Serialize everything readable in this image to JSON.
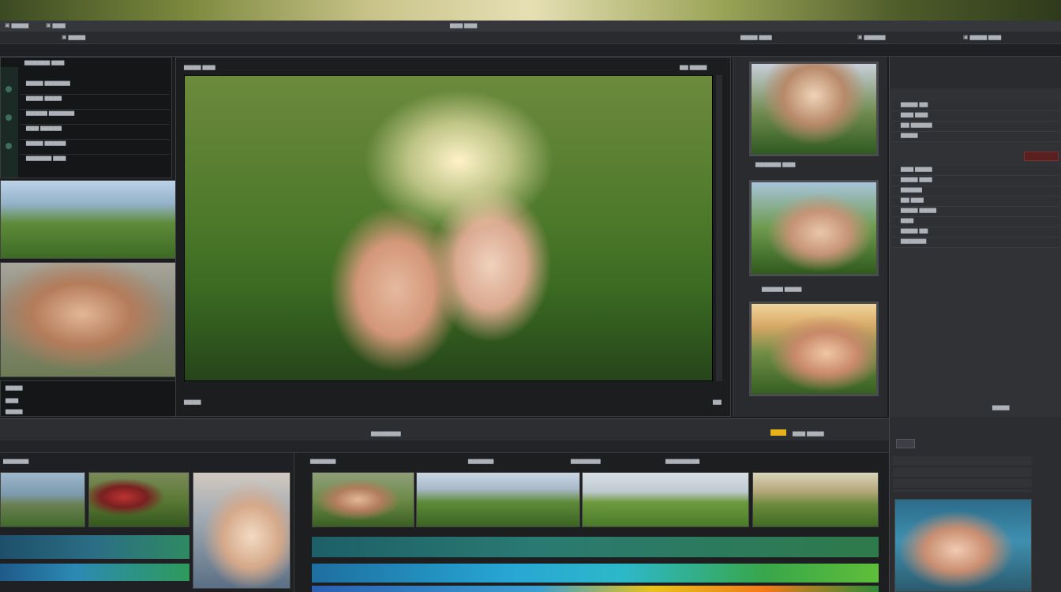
{
  "app": {
    "top_left_labels": [
      "▣ ▆▆▆▆",
      "▣ ▆▆▆",
      "▣ ▆▆▆▆"
    ],
    "top_center_label": "▆▆▆ ▆▆▆",
    "top_right_labels": [
      "▆▆▆▆ ▆▆▆",
      "▣ ▆▆▆▆▆",
      "▣ ▆▆▆▆ ▆▆▆"
    ]
  },
  "left_panel": {
    "header": "▆▆▆▆▆▆ ▆▆▆",
    "items": [
      "▆▆▆▆ ▆▆▆▆▆▆",
      "▆▆▆▆ ▆▆▆▆",
      "▆▆▆▆▆ ▆▆▆▆▆▆",
      "▆▆▆ ▆▆▆▆▆",
      "▆▆▆▆ ▆▆▆▆▆",
      "▆▆▆▆▆▆ ▆▆▆"
    ],
    "footer_labels": [
      "▆▆▆▆",
      "▆▆▆",
      "▆▆▆▆"
    ]
  },
  "viewer": {
    "header_left": "▆▆▆▆ ▆▆▆",
    "header_right": "▆▆ ▆▆▆▆",
    "footer_left": "▆▆▆▆",
    "footer_right": "▆▆"
  },
  "thumbs_column": {
    "captions": [
      "▆▆▆▆▆▆ ▆▆▆",
      "▆▆▆▆▆ ▆▆▆▆"
    ]
  },
  "right_properties": {
    "rows": [
      "▆▆▆▆ ▆▆",
      "▆▆▆ ▆▆▆",
      "▆▆ ▆▆▆▆▆",
      "▆▆▆▆",
      "▆▆▆ ▆▆▆▆",
      "▆▆▆▆ ▆▆▆",
      "▆▆▆▆▆",
      "▆▆ ▆▆▆",
      "▆▆▆▆ ▆▆▆▆",
      "▆▆▆",
      "▆▆▆▆ ▆▆",
      "▆▆▆▆▆▆"
    ],
    "bottom_label": "▆▆▆▆"
  },
  "timeline": {
    "center_label": "▆▆▆▆▆▆▆",
    "right_label": "▆▆▆ ▆▆▆▆",
    "left_track_label": "▆▆▆▆▆▆",
    "track_labels": [
      "▆▆▆▆▆▆",
      "▆▆▆▆▆▆",
      "▆▆▆▆▆▆▆",
      "▆▆▆▆▆▆▆▆"
    ],
    "accent_color": "#e6b21a"
  },
  "icons": [
    "play-icon",
    "settings-icon",
    "folder-icon",
    "scissors-icon",
    "eye-icon"
  ]
}
